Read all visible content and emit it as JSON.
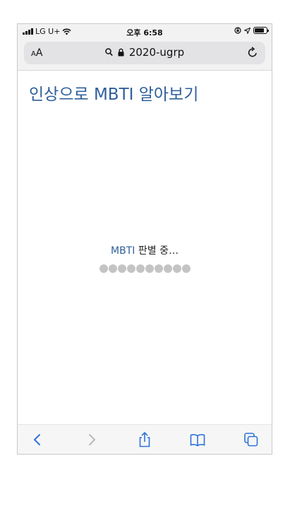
{
  "status_bar": {
    "carrier": "LG U+",
    "time": "오후 6:58"
  },
  "address_bar": {
    "aa_label_small": "A",
    "aa_label_large": "A",
    "url": "2020-ugrp"
  },
  "page": {
    "title": "인상으로 MBTI 알아보기",
    "loading_accent": "MBTI",
    "loading_rest": " 판별 중…",
    "dot_count": 10
  },
  "toolbar": {
    "icons": [
      "back-icon",
      "forward-icon",
      "share-icon",
      "bookmarks-icon",
      "tabs-icon"
    ]
  },
  "colors": {
    "accent": "#2f5f99",
    "ios_blue": "#2f73d9",
    "dot": "#c4c4c4"
  }
}
